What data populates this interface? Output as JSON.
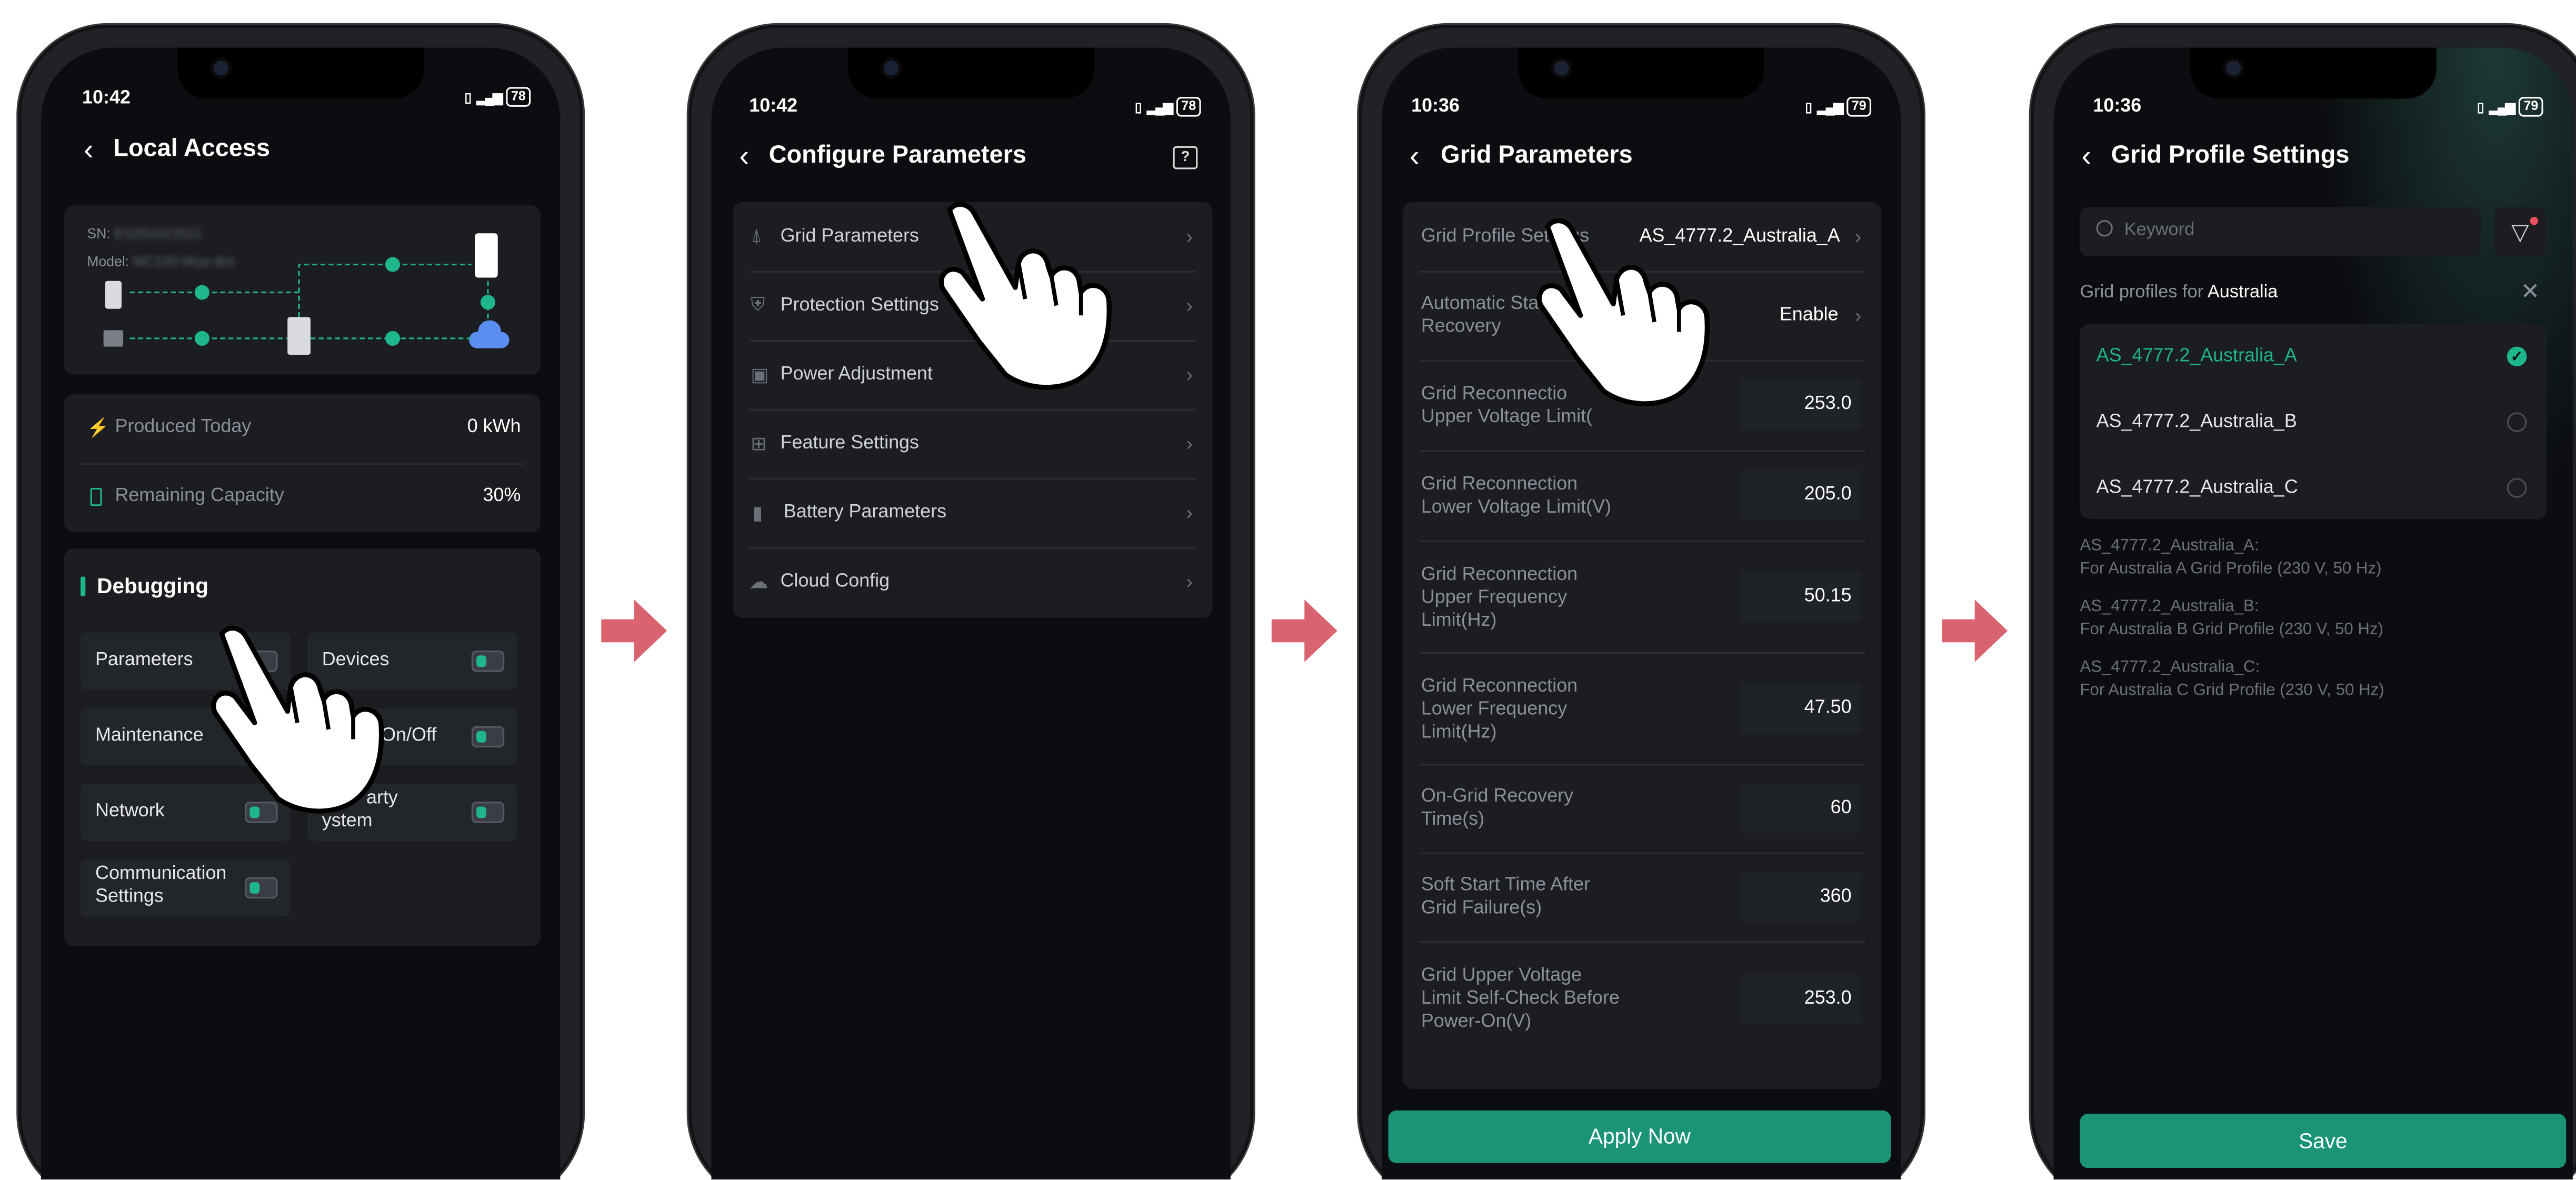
{
  "phones": {
    "p1": {
      "time": "10:42",
      "battery": "78",
      "title": "Local Access",
      "sn_label": "SN:",
      "sn_value": "ES251023511",
      "model_label": "Model:",
      "model_value": "MC100-Wye-8nt",
      "produced_label": "Produced Today",
      "produced_value": "0 kWh",
      "remaining_label": "Remaining Capacity",
      "remaining_value": "30%",
      "debugging_title": "Debugging",
      "buttons": {
        "parameters": "Parameters",
        "devices": "Devices",
        "maintenance": "Maintenance",
        "onoff": "On/Off",
        "network": "Network",
        "third_party_a": "arty",
        "third_party_b": "ystem",
        "comm_a": "Communication",
        "comm_b": "Settings"
      }
    },
    "p2": {
      "time": "10:42",
      "battery": "78",
      "title": "Configure Parameters",
      "items": [
        "Grid Parameters",
        "Protection Settings",
        "Power Adjustment",
        "Feature Settings",
        "Battery Parameters",
        "Cloud Config"
      ]
    },
    "p3": {
      "time": "10:36",
      "battery": "79",
      "title": "Grid Parameters",
      "profile_label": "Grid Profile Settings",
      "profile_value": "AS_4777.2_Australia_A",
      "auto_label_a": "Automatic Star",
      "auto_label_b": "Recovery",
      "auto_value": "Enable",
      "rows": [
        {
          "l1": "Grid Reconnectio",
          "l2": "Upper Voltage Limit(",
          "l3": "",
          "value": "253.0"
        },
        {
          "l1": "Grid Reconnection",
          "l2": "Lower Voltage Limit(V)",
          "l3": "",
          "value": "205.0"
        },
        {
          "l1": "Grid Reconnection",
          "l2": "Upper Frequency",
          "l3": "Limit(Hz)",
          "value": "50.15"
        },
        {
          "l1": "Grid Reconnection",
          "l2": "Lower Frequency",
          "l3": "Limit(Hz)",
          "value": "47.50"
        },
        {
          "l1": "On-Grid Recovery",
          "l2": "Time(s)",
          "l3": "",
          "value": "60"
        },
        {
          "l1": "Soft Start Time After",
          "l2": "Grid Failure(s)",
          "l3": "",
          "value": "360"
        },
        {
          "l1": "Grid Upper Voltage",
          "l2": "Limit Self-Check Before",
          "l3": "Power-On(V)",
          "value": "253.0"
        }
      ],
      "apply_label": "Apply Now"
    },
    "p4": {
      "time": "10:36",
      "battery": "79",
      "title": "Grid Profile Settings",
      "search_placeholder": "Keyword",
      "profiles_for": "Grid profiles for",
      "country": "Australia",
      "options": [
        "AS_4777.2_Australia_A",
        "AS_4777.2_Australia_B",
        "AS_4777.2_Australia_C"
      ],
      "notes": [
        {
          "name": "AS_4777.2_Australia_A:",
          "desc": "For Australia A Grid Profile (230 V, 50 Hz)"
        },
        {
          "name": "AS_4777.2_Australia_B:",
          "desc": "For Australia B Grid Profile (230 V, 50 Hz)"
        },
        {
          "name": "AS_4777.2_Australia_C:",
          "desc": "For Australia C Grid Profile (230 V, 50 Hz)"
        }
      ],
      "save_label": "Save"
    }
  },
  "colors": {
    "accent": "#1fb68b",
    "button": "#1a9377",
    "arrow": "#d9646f",
    "background": "#0c0d10"
  },
  "icons": [
    "back-arrow-icon",
    "help-icon",
    "lightning-icon",
    "battery-icon",
    "grid-icon",
    "shield-icon",
    "power-icon",
    "feature-icon",
    "cloud-icon",
    "search-icon",
    "filter-icon",
    "close-icon",
    "check-icon",
    "pointing-hand-icon"
  ]
}
